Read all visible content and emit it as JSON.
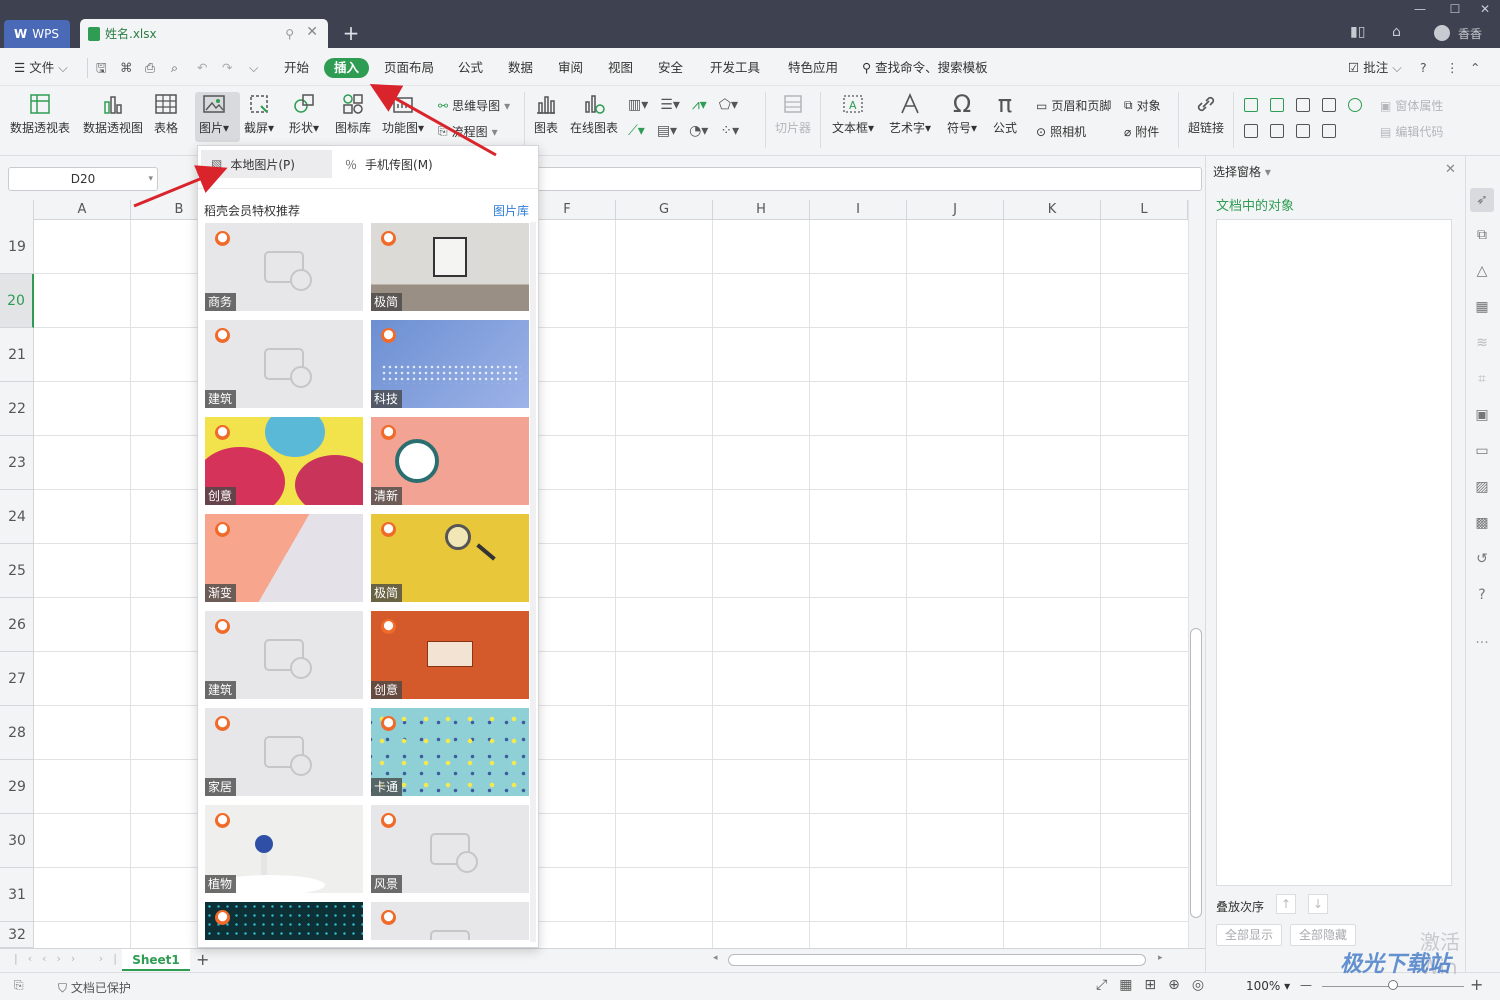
{
  "titlebar": {
    "wps_tab": "WPS",
    "file_tab": "姓名.xlsx",
    "user": "香香"
  },
  "menubar": {
    "file": "文件",
    "items": [
      "开始",
      "插入",
      "页面布局",
      "公式",
      "数据",
      "审阅",
      "视图",
      "安全",
      "开发工具",
      "特色应用"
    ],
    "active": "插入",
    "search": "查找命令、搜索模板",
    "comment": "批注"
  },
  "ribbon": {
    "pivot_table": "数据透视表",
    "pivot_chart": "数据透视图",
    "table": "表格",
    "picture": "图片",
    "screenshot": "截屏",
    "shape": "形状",
    "icon_lib": "图标库",
    "func_chart": "功能图",
    "mind_map": "思维导图",
    "flowchart": "流程图",
    "chart": "图表",
    "online_chart": "在线图表",
    "slicer": "切片器",
    "textbox": "文本框",
    "wordart": "艺术字",
    "symbol": "符号",
    "formula": "公式",
    "header_footer": "页眉和页脚",
    "camera": "照相机",
    "object": "对象",
    "attachment": "附件",
    "hyperlink": "超链接",
    "form_props": "窗体属性",
    "edit_code": "编辑代码"
  },
  "formula": {
    "name_box": "D20"
  },
  "sheet": {
    "columns": [
      "A",
      "B",
      "F",
      "G",
      "H",
      "I",
      "J",
      "K",
      "L"
    ],
    "rows": [
      "19",
      "20",
      "21",
      "22",
      "23",
      "24",
      "25",
      "26",
      "27",
      "28",
      "29",
      "30",
      "31",
      "32"
    ],
    "active_row": "20",
    "tab": "Sheet1"
  },
  "dropdown": {
    "local_picture": "本地图片(P)",
    "phone_picture": "手机传图(M)",
    "section_title": "稻壳会员特权推荐",
    "library_link": "图片库",
    "thumbnails": [
      {
        "label": "商务",
        "style": "placeholder"
      },
      {
        "label": "极简",
        "style": "frame"
      },
      {
        "label": "建筑",
        "style": "placeholder"
      },
      {
        "label": "科技",
        "style": "tech"
      },
      {
        "label": "创意",
        "style": "creative"
      },
      {
        "label": "清新",
        "style": "clock"
      },
      {
        "label": "渐变",
        "style": "gradient"
      },
      {
        "label": "极简",
        "style": "magnifier"
      },
      {
        "label": "建筑",
        "style": "placeholder"
      },
      {
        "label": "创意",
        "style": "pattern"
      },
      {
        "label": "家居",
        "style": "placeholder"
      },
      {
        "label": "卡通",
        "style": "cartoon"
      },
      {
        "label": "植物",
        "style": "plant"
      },
      {
        "label": "风景",
        "style": "placeholder"
      },
      {
        "label": "",
        "style": "dark"
      },
      {
        "label": "",
        "style": "placeholder"
      }
    ]
  },
  "right_pane": {
    "title": "选择窗格",
    "objects_heading": "文档中的对象",
    "order_label": "叠放次序",
    "show_all": "全部显示",
    "hide_all": "全部隐藏"
  },
  "statusbar": {
    "protected": "文档已保护",
    "zoom": "100%"
  },
  "overlay": {
    "activate": "激活 Win",
    "watermark": "极光下载站"
  },
  "colors": {
    "accent": "#2e9d53",
    "titlebar": "#3e4150",
    "arrow": "#d9242b"
  }
}
